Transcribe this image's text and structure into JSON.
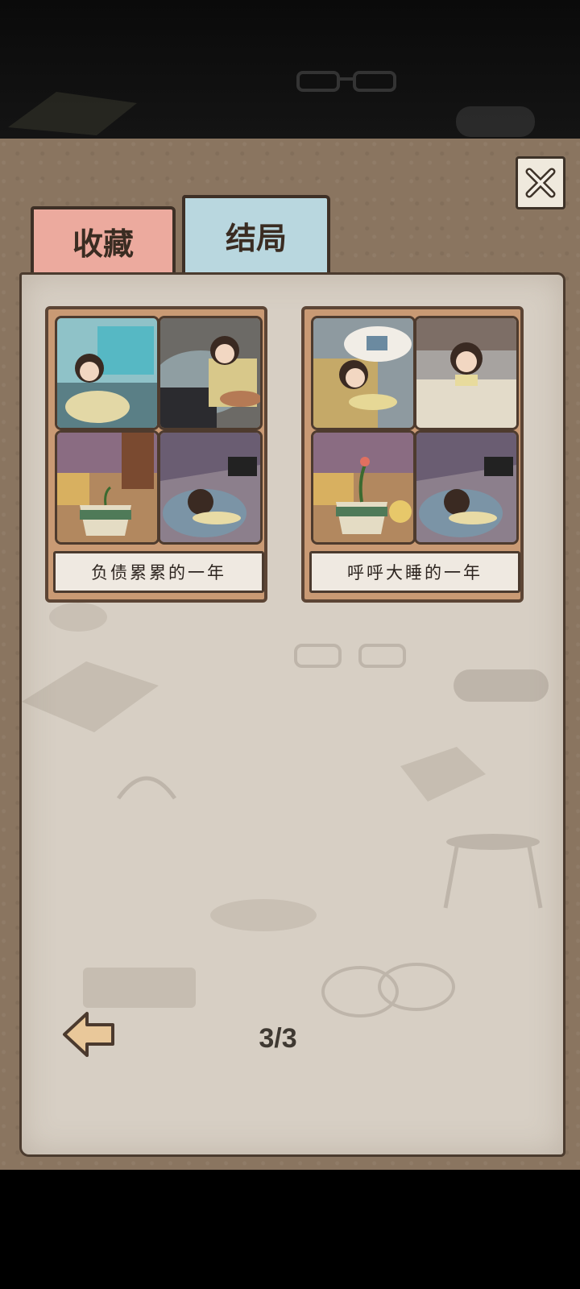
{
  "tabs": {
    "collection": "收藏",
    "ending": "结局"
  },
  "endings": [
    {
      "title": "负债累累的一年"
    },
    {
      "title": "呼呼大睡的一年"
    }
  ],
  "pagination": {
    "indicator": "3/3"
  },
  "icons": {
    "close": "close-x-icon",
    "back": "back-arrow-icon"
  },
  "colors": {
    "tab_collection": "#ecaa9e",
    "tab_ending": "#b9d7df",
    "paper": "#d7cfc4",
    "board": "#8a7560"
  }
}
